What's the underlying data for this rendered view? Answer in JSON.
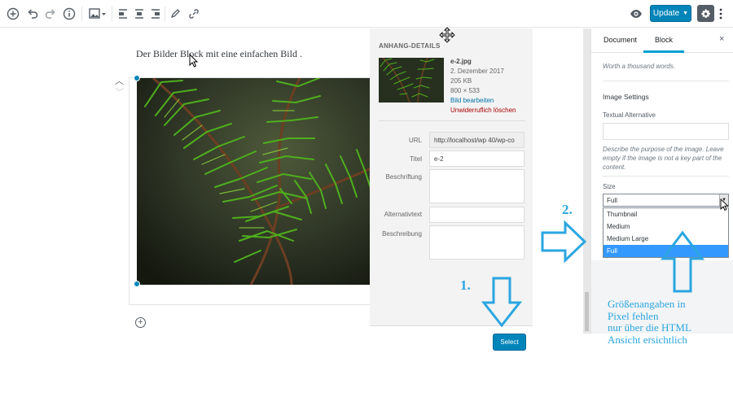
{
  "toolbar": {
    "icons": [
      "add-icon",
      "undo-icon",
      "redo-icon",
      "info-icon",
      "image-icon",
      "align-left-icon",
      "align-center-icon",
      "align-right-icon",
      "pencil-icon",
      "link-icon",
      "eye-icon",
      "gear-icon",
      "more-icon"
    ],
    "update_label": "Update"
  },
  "editor": {
    "paragraph": "Der Bilder Block mit eine einfachen Bild ."
  },
  "media": {
    "section_title": "ANHANG-DETAILS",
    "filename": "e-2.jpg",
    "date": "2. Dezember 2017",
    "filesize": "205 KB",
    "dimensions": "800 × 533",
    "edit_link": "Bild bearbeiten",
    "delete_link": "Unwiderruflich löschen",
    "fields": {
      "url_label": "URL",
      "url_value": "http://localhost/wp 40/wp-co",
      "title_label": "Titel",
      "title_value": "e-2",
      "caption_label": "Beschriftung",
      "alt_label": "Alternativtext",
      "desc_label": "Beschreibung"
    },
    "select_label": "Select"
  },
  "sidebar": {
    "tab_document": "Document",
    "tab_block": "Block",
    "close": "×",
    "worth_text": "Worth a thousand words.",
    "image_settings": "Image Settings",
    "textual_alt_label": "Textual Alternative",
    "alt_help": [
      "Describe the purpose of the image. Leave",
      "empty if the image is not a key part of the",
      "content."
    ],
    "size_label": "Size",
    "size_selected": "Full",
    "size_options": [
      "Thumbnail",
      "Medium",
      "Medium Large",
      "Full"
    ]
  },
  "annotations": {
    "step1": "1.",
    "step2": "2.",
    "note_lines": [
      "Größenangaben in",
      "Pixel fehlen",
      "nur über die HTML",
      "Ansicht ersichtlich"
    ],
    "color": "#2ba6e1"
  },
  "colors": {
    "primary": "#0085ba",
    "tab_accent": "#00a0d2",
    "option_highlight": "#3399ff",
    "danger": "#aa0000"
  }
}
